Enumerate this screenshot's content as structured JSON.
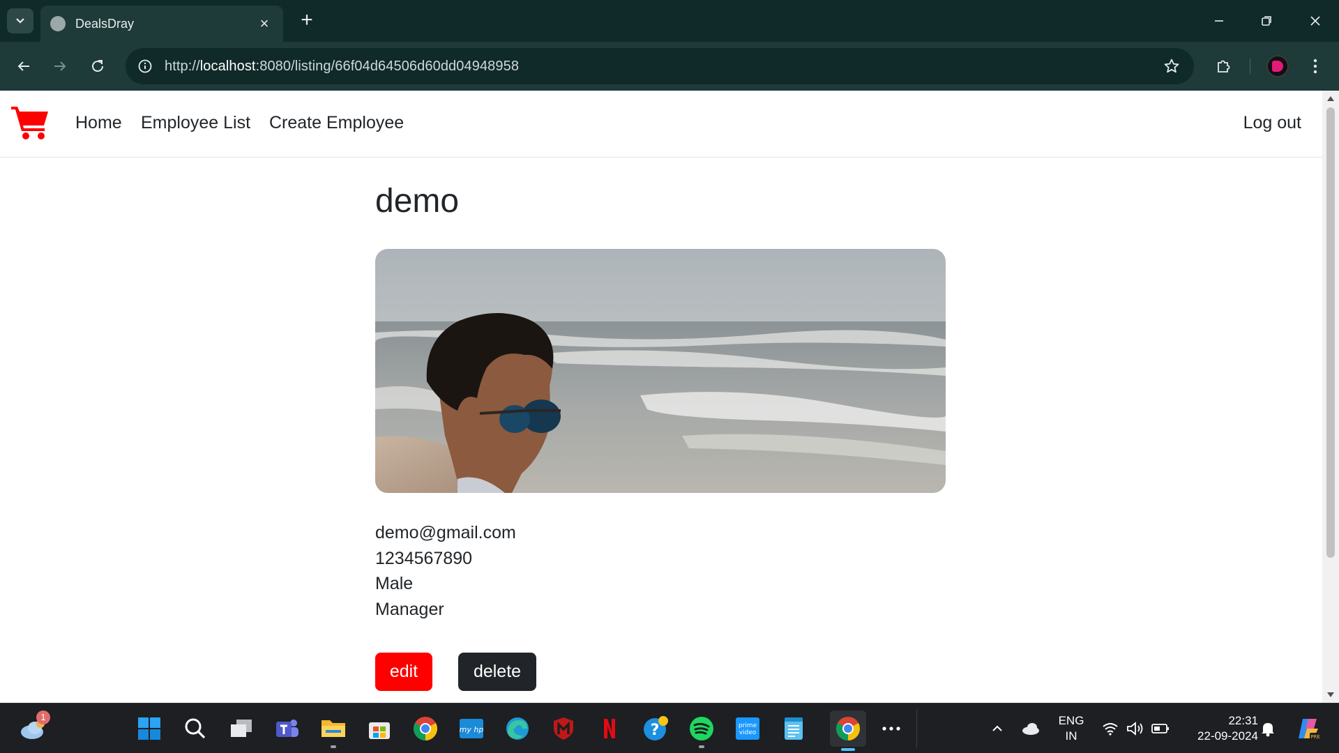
{
  "browser": {
    "tab_title": "DealsDray",
    "url_prefix": "http://",
    "url_host": "localhost",
    "url_rest": ":8080/listing/66f04d64506d60dd04948958"
  },
  "site": {
    "nav": {
      "home": "Home",
      "employee_list": "Employee List",
      "create_employee": "Create Employee",
      "logout": "Log out"
    }
  },
  "employee": {
    "name": "demo",
    "email": "demo@gmail.com",
    "phone": "1234567890",
    "gender": "Male",
    "designation": "Manager",
    "edit_label": "edit",
    "delete_label": "delete"
  },
  "taskbar": {
    "weather_badge": "1",
    "lang_line1": "ENG",
    "lang_line2": "IN",
    "time": "22:31",
    "date": "22-09-2024",
    "apps": [
      "start-icon",
      "search-icon",
      "task-view-icon",
      "teams-icon",
      "file-explorer-icon",
      "microsoft-store-icon",
      "chrome-icon",
      "myhp-icon",
      "edge-icon",
      "mcafee-icon",
      "netflix-icon",
      "help-icon",
      "spotify-icon",
      "prime-video-icon",
      "notepad-icon",
      "chrome-icon",
      "more-icon"
    ]
  },
  "colors": {
    "brand_red": "#ff0000",
    "dark_button": "#212529",
    "chrome_dark": "#0f2a29",
    "chrome_mid": "#1e3a39"
  }
}
